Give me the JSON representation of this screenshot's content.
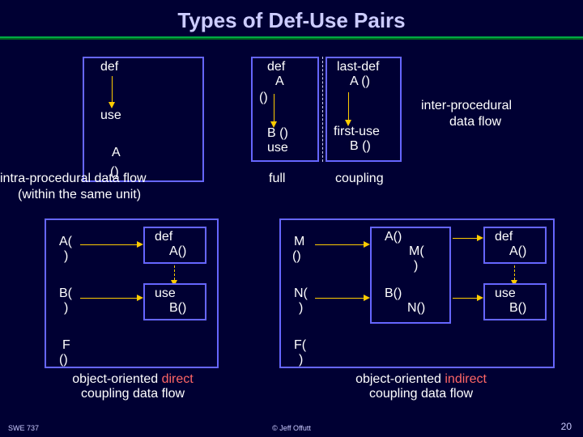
{
  "title": "Types of Def-Use Pairs",
  "box1": {
    "def": "def",
    "use": "use",
    "A": "A",
    "parens": "()"
  },
  "intra": {
    "line1": "intra-procedural data flow",
    "line2": "(within the same unit)"
  },
  "box2a": {
    "defA": "def",
    "A": "A",
    "p": "()",
    "Bp": "B ()",
    "use": "use",
    "last": "last-def",
    "lastA": "A ()",
    "first": "first-use",
    "firstB": "B ()"
  },
  "full": "full",
  "coupling": "coupling",
  "inter": {
    "line1": "inter-procedural",
    "line2": "data flow"
  },
  "bottomLeft": {
    "A": "A(",
    "Ap": ")",
    "B": "B(",
    "Bp": ")",
    "F": "F",
    "Fp": "()",
    "defA": "def",
    "defAp": "A()",
    "useB": "use",
    "useBp": "B()",
    "caption1": "object-oriented",
    "caption2": "direct",
    "caption3": "coupling data flow"
  },
  "bottomRight": {
    "M": "M",
    "Mp": "()",
    "N": "N(",
    "Np": ")",
    "F": "F(",
    "Fp": ")",
    "A": "A()",
    "Mc": "M(",
    "Mcp": ")",
    "Bc": "B()",
    "Nc": "N()",
    "defA": "def",
    "defAp": "A()",
    "useB": "use",
    "useBp": "B()",
    "caption1": "object-oriented",
    "caption2": "indirect",
    "caption3": "coupling data flow"
  },
  "footer": {
    "left": "SWE 737",
    "center": "© Jeff Offutt",
    "right": "20"
  }
}
